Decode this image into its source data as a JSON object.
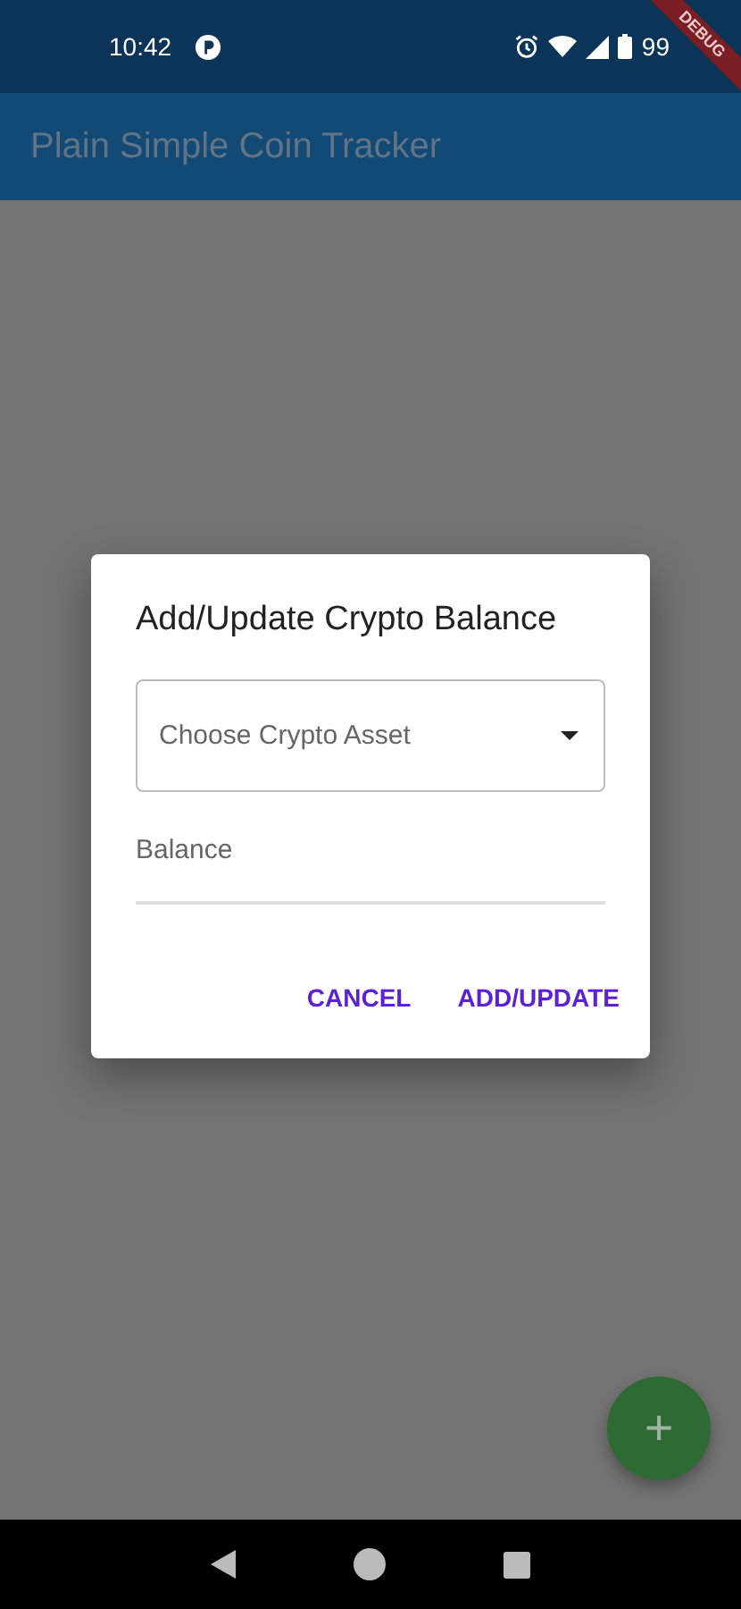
{
  "status_bar": {
    "time": "10:42",
    "battery": "99"
  },
  "debug_banner": "DEBUG",
  "app_bar": {
    "title": "Plain Simple Coin Tracker"
  },
  "dialog": {
    "title": "Add/Update Crypto Balance",
    "dropdown": {
      "placeholder": "Choose Crypto Asset",
      "expanded": false
    },
    "balance_field": {
      "placeholder": "Balance"
    },
    "buttons": [
      "CANCEL",
      "ADD/UPDATE"
    ]
  },
  "fab": {
    "label": "+"
  }
}
